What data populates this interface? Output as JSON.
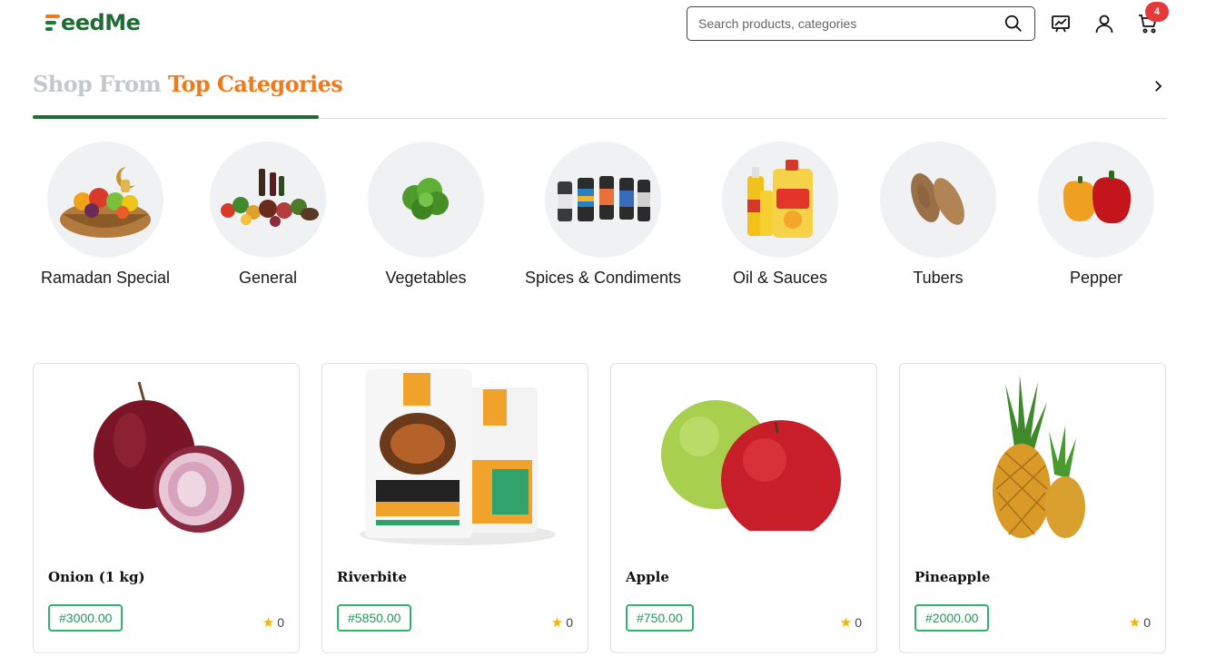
{
  "header": {
    "logo_text": "eedMe",
    "search": {
      "placeholder": "Search products, categories"
    },
    "icons": [
      "search-icon",
      "chart-icon",
      "user-icon",
      "cart-icon"
    ],
    "cart_count": "4"
  },
  "section": {
    "title_muted": "Shop From",
    "title_accent": "Top Categories"
  },
  "categories": [
    {
      "label": "Ramadan Special"
    },
    {
      "label": "General"
    },
    {
      "label": "Vegetables"
    },
    {
      "label": "Spices & Condiments"
    },
    {
      "label": "Oil & Sauces"
    },
    {
      "label": "Tubers"
    },
    {
      "label": "Pepper"
    }
  ],
  "products": [
    {
      "name": "Onion (1 kg)",
      "price": "#3000.00",
      "rating": "0"
    },
    {
      "name": "Riverbite",
      "price": "#5850.00",
      "rating": "0"
    },
    {
      "name": "Apple",
      "price": "#750.00",
      "rating": "0"
    },
    {
      "name": "Pineapple",
      "price": "#2000.00",
      "rating": "0"
    }
  ],
  "colors": {
    "brand_green": "#1f6b34",
    "brand_orange": "#f07a1a",
    "price_green": "#2fb36b",
    "badge_red": "#e63939",
    "star": "#f5b400"
  }
}
